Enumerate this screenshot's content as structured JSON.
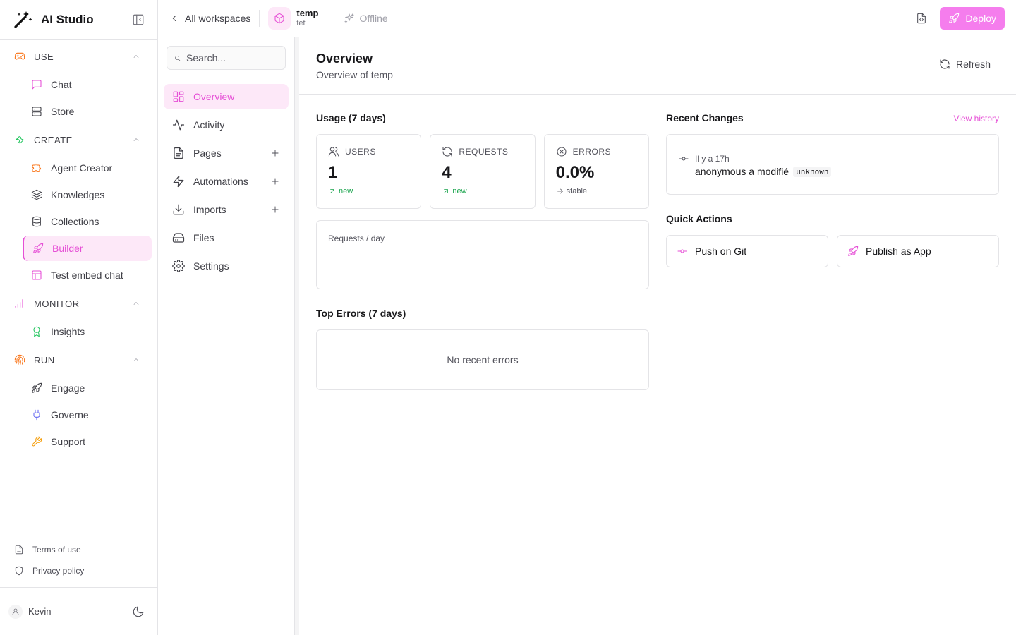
{
  "app": {
    "name": "AI Studio",
    "accent": "#e64fd6",
    "deploy_color": "#f57ded"
  },
  "topbar": {
    "back_label": "All workspaces",
    "workspace_name": "temp",
    "workspace_sub": "tet",
    "status": "Offline",
    "deploy_label": "Deploy"
  },
  "sidebar": {
    "sections": [
      {
        "label": "USE",
        "icon": "gamepad-icon",
        "color": "#f97316",
        "items": [
          {
            "label": "Chat",
            "icon": "message-square-icon",
            "color": "#e64fd6"
          },
          {
            "label": "Store",
            "icon": "server-icon",
            "color": "#52525b"
          }
        ]
      },
      {
        "label": "CREATE",
        "icon": "wrench-icon",
        "color": "#22c55e",
        "items": [
          {
            "label": "Agent Creator",
            "icon": "puzzle-icon",
            "color": "#f97316"
          },
          {
            "label": "Knowledges",
            "icon": "layers-icon",
            "color": "#52525b"
          },
          {
            "label": "Collections",
            "icon": "database-icon",
            "color": "#52525b"
          },
          {
            "label": "Builder",
            "icon": "rocket-icon",
            "color": "#e64fd6",
            "active": true
          },
          {
            "label": "Test embed chat",
            "icon": "layout-icon",
            "color": "#e64fd6"
          }
        ]
      },
      {
        "label": "MONITOR",
        "icon": "bar-signal-icon",
        "color": "#e64fd6",
        "items": [
          {
            "label": "Insights",
            "icon": "award-icon",
            "color": "#22c55e"
          }
        ]
      },
      {
        "label": "RUN",
        "icon": "fingerprint-icon",
        "color": "#f97316",
        "items": [
          {
            "label": "Engage",
            "icon": "rocket-icon",
            "color": "#52525b"
          },
          {
            "label": "Governe",
            "icon": "plug-icon",
            "color": "#6366f1"
          },
          {
            "label": "Support",
            "icon": "wrench-icon",
            "color": "#f59e0b"
          }
        ]
      }
    ],
    "footer_links": [
      {
        "label": "Terms of use",
        "icon": "file-text-icon"
      },
      {
        "label": "Privacy policy",
        "icon": "shield-icon"
      }
    ],
    "user": {
      "name": "Kevin"
    }
  },
  "subnav": {
    "search_placeholder": "Search...",
    "items": [
      {
        "label": "Overview",
        "icon": "grid-icon",
        "active": true,
        "plus": false
      },
      {
        "label": "Activity",
        "icon": "activity-icon",
        "plus": false
      },
      {
        "label": "Pages",
        "icon": "file-icon",
        "plus": true
      },
      {
        "label": "Automations",
        "icon": "zap-icon",
        "plus": true
      },
      {
        "label": "Imports",
        "icon": "download-icon",
        "plus": true
      },
      {
        "label": "Files",
        "icon": "hard-drive-icon",
        "plus": false
      },
      {
        "label": "Settings",
        "icon": "settings-icon",
        "plus": false
      }
    ]
  },
  "main": {
    "title": "Overview",
    "subtitle": "Overview of temp",
    "refresh_label": "Refresh",
    "usage_title": "Usage (7 days)",
    "stats": [
      {
        "label": "USERS",
        "value": "1",
        "trend": "new",
        "trend_dir": "up",
        "icon": "users-icon"
      },
      {
        "label": "REQUESTS",
        "value": "4",
        "trend": "new",
        "trend_dir": "up",
        "icon": "refresh-icon"
      },
      {
        "label": "ERRORS",
        "value": "0.0%",
        "trend": "stable",
        "trend_dir": "flat",
        "icon": "x-circle-icon"
      }
    ],
    "requests_chart_label": "Requests / day",
    "top_errors_title": "Top Errors (7 days)",
    "no_errors_text": "No recent errors",
    "recent_changes_title": "Recent Changes",
    "view_history_label": "View history",
    "change": {
      "time": "Il y a 17h",
      "author": "anonymous",
      "action": "a modifié",
      "target": "unknown"
    },
    "quick_actions_title": "Quick Actions",
    "quick_actions": [
      {
        "label": "Push on Git",
        "icon": "git-commit-icon"
      },
      {
        "label": "Publish as App",
        "icon": "rocket-icon"
      }
    ]
  }
}
